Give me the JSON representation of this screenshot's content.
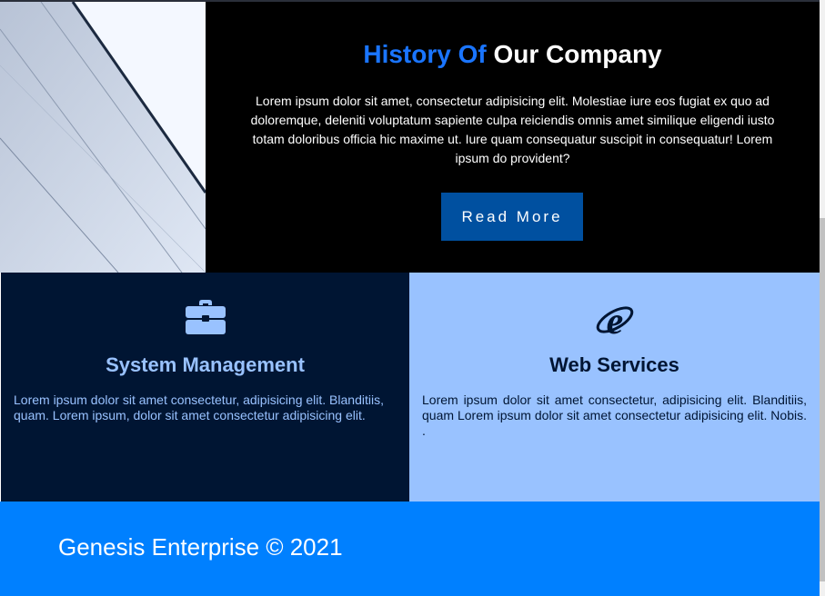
{
  "history": {
    "title_accent": "History Of",
    "title_main": "Our Company",
    "text": "Lorem ipsum dolor sit amet, consectetur adipisicing elit. Molestiae iure eos fugiat ex quo ad doloremque, deleniti voluptatum sapiente culpa reiciendis omnis amet similique eligendi iusto totam doloribus officia hic maxime ut. Iure quam consequatur suscipit in consequatur! Lorem ipsum do provident?",
    "button_label": "Read More"
  },
  "services": [
    {
      "icon": "briefcase-icon",
      "title": "System Management",
      "text": "Lorem ipsum dolor sit amet consectetur, adipisicing elit. Blanditiis, quam. Lorem ipsum, dolor sit amet consectetur adipisicing elit."
    },
    {
      "icon": "internet-explorer-icon",
      "title": "Web Services",
      "text": "Lorem ipsum dolor sit amet consectetur, adipisicing elit. Blanditiis, quam Lorem ipsum dolor sit amet consectetur adipisicing elit. Nobis. ."
    }
  ],
  "footer": {
    "text": "Genesis Enterprise © 2021"
  },
  "colors": {
    "accent_blue": "#1a75ff",
    "button_blue": "#0050a0",
    "dark_navy": "#001533",
    "light_blue": "#99c2ff",
    "footer_blue": "#0080ff"
  }
}
